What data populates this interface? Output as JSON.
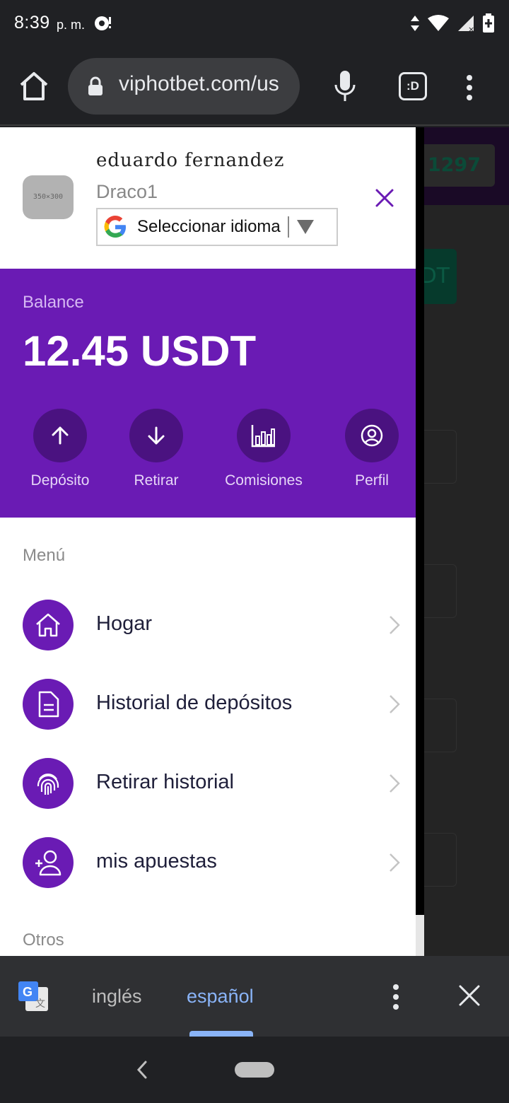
{
  "status_bar": {
    "time": "8:39",
    "ampm": "p. m."
  },
  "browser": {
    "url": "viphotbet.com/us",
    "tabs_label": ":D"
  },
  "background_page": {
    "header_value": "1297",
    "button_text": "DT"
  },
  "profile": {
    "name": "eduardo fernandez",
    "username": "Draco1",
    "avatar_placeholder": "350×300",
    "language_select": "Seleccionar idioma"
  },
  "balance": {
    "label": "Balance",
    "value": "12.45 USDT",
    "actions": [
      {
        "label": "Depósito",
        "icon": "arrow-up-icon"
      },
      {
        "label": "Retirar",
        "icon": "arrow-down-icon"
      },
      {
        "label": "Comisiones",
        "icon": "bar-chart-icon"
      },
      {
        "label": "Perfil",
        "icon": "user-circle-icon"
      }
    ]
  },
  "menu": {
    "heading": "Menú",
    "items": [
      {
        "label": "Hogar",
        "icon": "home-icon"
      },
      {
        "label": "Historial de depósitos",
        "icon": "document-icon"
      },
      {
        "label": "Retirar historial",
        "icon": "fingerprint-icon"
      },
      {
        "label": "mis apuestas",
        "icon": "add-user-icon"
      }
    ],
    "others_heading": "Otros"
  },
  "translate_bar": {
    "source_lang": "inglés",
    "target_lang": "español"
  },
  "colors": {
    "brand": "#6a1bb4",
    "brand_dark": "#4a1280",
    "link_blue": "#8ab4f8"
  }
}
